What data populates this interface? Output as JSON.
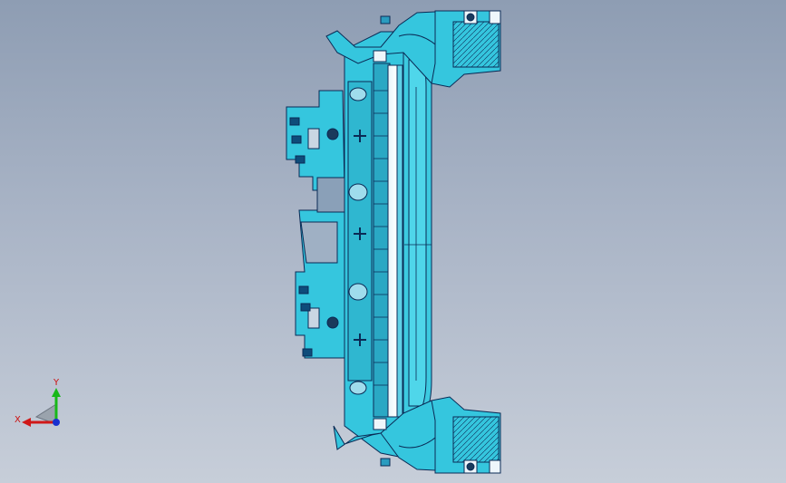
{
  "viewport": {
    "background_top": "#8e9db3",
    "background_bottom": "#c7ced9"
  },
  "model": {
    "part_color": "#35c6de",
    "edge_color": "#0a2a55",
    "part_semantics": "cad-bracket-assembly"
  },
  "triad": {
    "x_label": "X",
    "y_label": "Y",
    "x_color": "#d01818",
    "y_color": "#18b818",
    "z_color": "#1830d0"
  }
}
